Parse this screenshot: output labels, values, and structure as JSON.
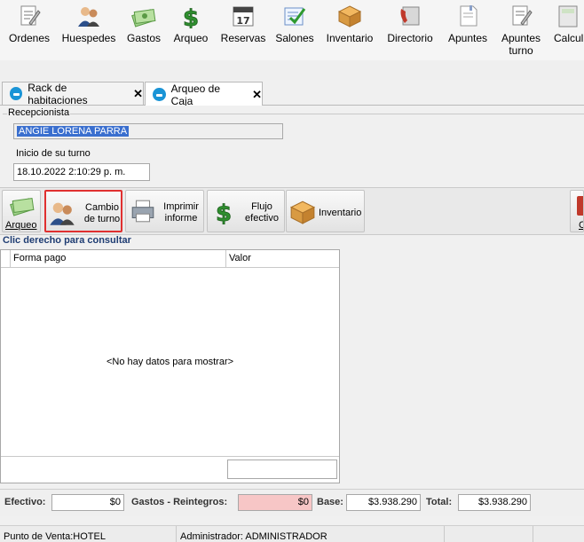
{
  "toolbar": {
    "items": [
      {
        "label": "Ordenes",
        "icon": "orders-icon",
        "accent": "0"
      },
      {
        "label": "Huespedes",
        "icon": "guests-icon",
        "accent": "0"
      },
      {
        "label": "Gastos",
        "icon": "expenses-icon",
        "accent": "0"
      },
      {
        "label": "Arqueo",
        "icon": "cash-count-icon",
        "accent": "0"
      },
      {
        "label": "Reservas",
        "icon": "calendar-icon",
        "accent": "0"
      },
      {
        "label": "Salones",
        "icon": "checklist-icon",
        "accent": "0"
      },
      {
        "label": "Inventario",
        "icon": "box-icon",
        "accent": "0"
      },
      {
        "label": "Directorio",
        "icon": "phone-icon",
        "accent": "0"
      },
      {
        "label": "Apuntes",
        "icon": "notes-icon",
        "accent": "0"
      },
      {
        "label": "Apuntes turno",
        "icon": "shift-notes-icon",
        "accent": "0"
      },
      {
        "label": "Calcul",
        "icon": "calculator-icon",
        "accent": "0"
      }
    ],
    "calendar_day": "17"
  },
  "tabs": [
    {
      "label": "Rack de habitaciones",
      "close": "✕"
    },
    {
      "label": "Arqueo de Caja",
      "close": "✕"
    }
  ],
  "form": {
    "recepcionista_label": "Recepcionista",
    "recepcionista_value": "ANGIE LORENA PARRA",
    "inicio_label": "Inicio de su turno",
    "inicio_value": "18.10.2022 2:10:29 p. m."
  },
  "actions": {
    "arqueo": "Arqueo",
    "cambio_line1": "Cambio",
    "cambio_line2": "de turno",
    "imprimir_line1": "Imprimir",
    "imprimir_line2": "informe",
    "flujo_line1": "Flujo",
    "flujo_line2": "efectivo",
    "inventario": "Inventario",
    "right_partial": "C"
  },
  "grid": {
    "hint": "Clic derecho para consultar",
    "columns": [
      "Forma pago",
      "Valor"
    ],
    "empty": "<No hay datos para mostrar>"
  },
  "totals": {
    "efectivo_label": "Efectivo:",
    "efectivo_value": "$0",
    "gastos_label": "Gastos - Reintegros:",
    "gastos_value": "$0",
    "base_label": "Base:",
    "base_value": "$3.938.290",
    "total_label": "Total:",
    "total_value": "$3.938.290"
  },
  "status": {
    "punto": "Punto de Venta:HOTEL",
    "admin": "Administrador: ADMINISTRADOR"
  },
  "colors": {
    "highlight": "#e03030",
    "selection": "#3a6fcf",
    "gastos_bg": "#f7c6c6",
    "tab_icon": "#1a94d6",
    "section_text": "#1f3d73"
  }
}
